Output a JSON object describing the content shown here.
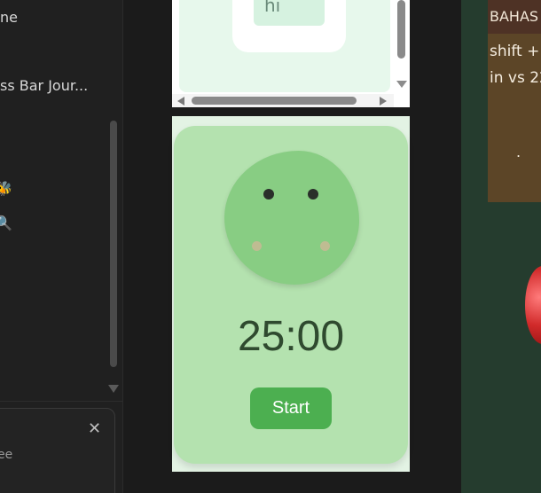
{
  "sidebar": {
    "items": [
      {
        "label": "ne"
      },
      {
        "label": "ss Bar Jour..."
      }
    ],
    "emoji_items": [
      {
        "icon": "bee-icon",
        "glyph": "🐝"
      },
      {
        "icon": "magnifier-icon",
        "glyph": "🔍"
      }
    ],
    "notification": {
      "close_glyph": "✕",
      "text": "ee"
    }
  },
  "top_pane": {
    "chip_text": "hi"
  },
  "timer": {
    "display": "25:00",
    "start_label": "Start"
  },
  "right_panel": {
    "header": "BAHAS",
    "line1": "shift +",
    "line2": "in vs 22",
    "dot": "."
  },
  "colors": {
    "timer_card": "#b4e2af",
    "mascot": "#88cd83",
    "start_button": "#4caf50",
    "note_card": "#5c4527"
  }
}
